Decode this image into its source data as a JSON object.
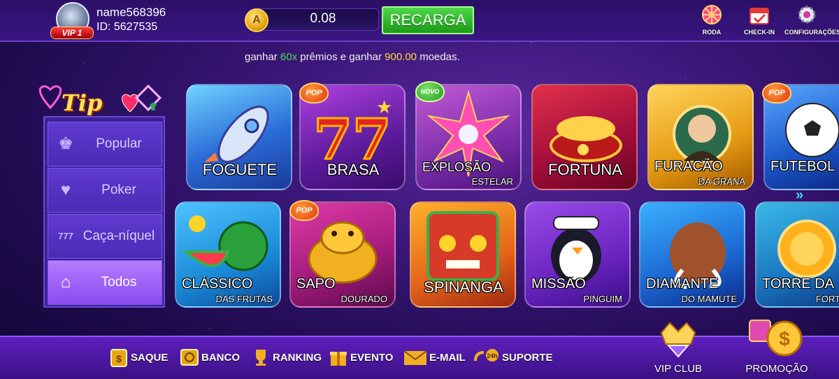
{
  "user": {
    "name": "name568396",
    "id": "ID: 5627535",
    "vip": "VIP 1"
  },
  "wallet": {
    "balance": "0.08",
    "recharge_label": "RECARGA"
  },
  "top_actions": [
    {
      "label": "RODA",
      "icon": "wheel-icon"
    },
    {
      "label": "CHECK-IN",
      "icon": "calendar-icon"
    },
    {
      "label": "CONFIGURAÇÕES",
      "icon": "gear-icon"
    }
  ],
  "marquee": {
    "p1": "ganhar ",
    "mult": "60x",
    "p2": " prêmios e ganhar ",
    "amount": "900.00",
    "p3": "  moedas."
  },
  "sidebar": {
    "header": "Tip",
    "items": [
      {
        "label": "Popular",
        "icon": "crown-icon",
        "active": false
      },
      {
        "label": "Poker",
        "icon": "poker-icon",
        "active": false
      },
      {
        "label": "Caça-níquel",
        "icon": "slot-777-icon",
        "active": false
      },
      {
        "label": "Todos",
        "icon": "home-icon",
        "active": true
      }
    ]
  },
  "games": [
    {
      "title": "FOGUETE",
      "subtitle": "",
      "badge": ""
    },
    {
      "title": "BRASA",
      "subtitle": "",
      "badge": "POP"
    },
    {
      "title": "EXPLOSÃO",
      "subtitle": "ESTELAR",
      "badge": "NOVO"
    },
    {
      "title": "FORTUNA",
      "subtitle": "",
      "badge": ""
    },
    {
      "title": "FURACÃO",
      "subtitle": "DA GRANA",
      "badge": ""
    },
    {
      "title": "FUTEBOL",
      "subtitle": "",
      "badge": "POP"
    },
    {
      "title": "CLÁSSICO",
      "subtitle": "DAS FRUTAS",
      "badge": ""
    },
    {
      "title": "SAPO",
      "subtitle": "DOURADO",
      "badge": "POP"
    },
    {
      "title": "SPINANGA",
      "subtitle": "",
      "badge": ""
    },
    {
      "title": "MISSÃO",
      "subtitle": "PINGUIM",
      "badge": ""
    },
    {
      "title": "DIAMANTE",
      "subtitle": "DO MAMUTE",
      "badge": ""
    },
    {
      "title": "TORRE DA",
      "subtitle": "FORT",
      "badge": ""
    }
  ],
  "bottom_nav": [
    {
      "label": "SAQUE",
      "icon": "withdraw-icon"
    },
    {
      "label": "BANCO",
      "icon": "safe-icon"
    },
    {
      "label": "RANKING",
      "icon": "trophy-icon"
    },
    {
      "label": "EVENTO",
      "icon": "gift-icon"
    },
    {
      "label": "E-MAIL",
      "icon": "mail-icon"
    },
    {
      "label": "SUPORTE",
      "icon": "support-24h-icon"
    }
  ],
  "vip_club": {
    "label": "VIP CLUB"
  },
  "promo": {
    "label": "PROMOÇÃO"
  },
  "colors": {
    "accent_green": "#3fe04a",
    "accent_yellow": "#ffd83a",
    "recharge": "#1b9a16"
  }
}
